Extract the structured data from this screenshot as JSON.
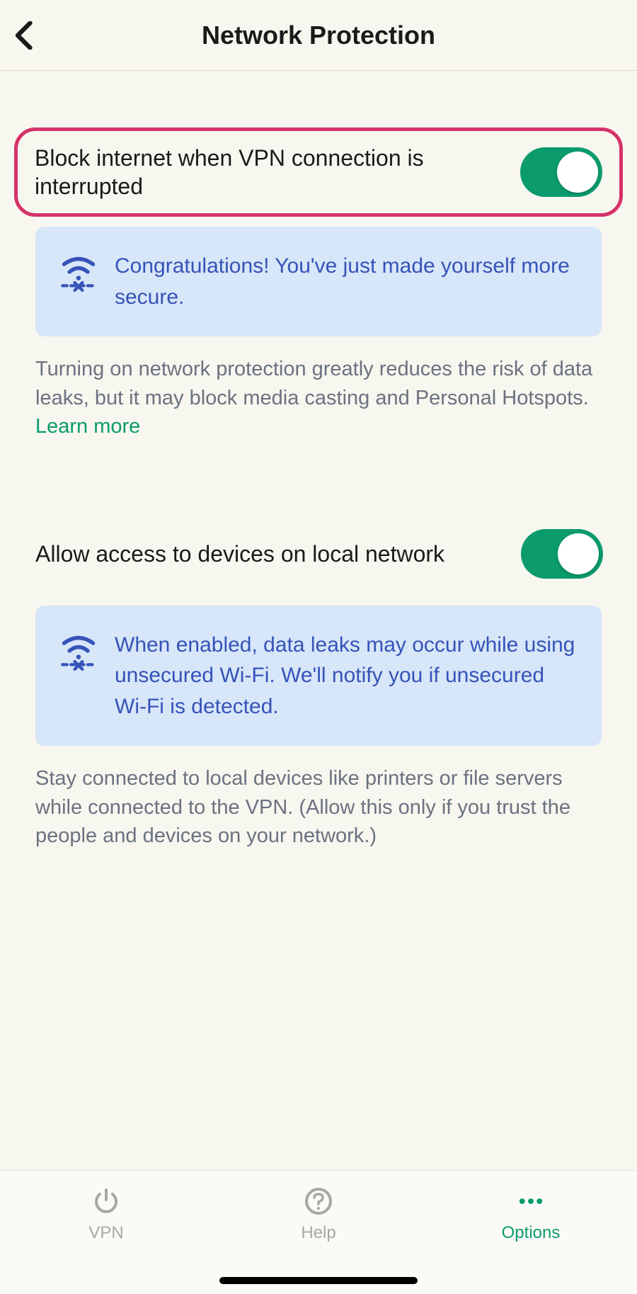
{
  "header": {
    "title": "Network Protection"
  },
  "settings": {
    "block_internet": {
      "label": "Block internet when VPN connection is interrupted",
      "info": "Congratulations! You've just made yourself more secure.",
      "description": "Turning on network protection greatly reduces the risk of data leaks, but it may block media casting and Personal Hotspots. ",
      "learn_more": "Learn more"
    },
    "local_access": {
      "label": "Allow access to devices on local network",
      "info": "When enabled, data leaks may occur while using unsecured Wi-Fi. We'll notify you if unsecured Wi-Fi is detected.",
      "description": "Stay connected to local devices like printers or file servers while connected to the VPN. (Allow this only if you trust the people and devices on your network.)"
    }
  },
  "tabs": {
    "vpn": "VPN",
    "help": "Help",
    "options": "Options"
  }
}
